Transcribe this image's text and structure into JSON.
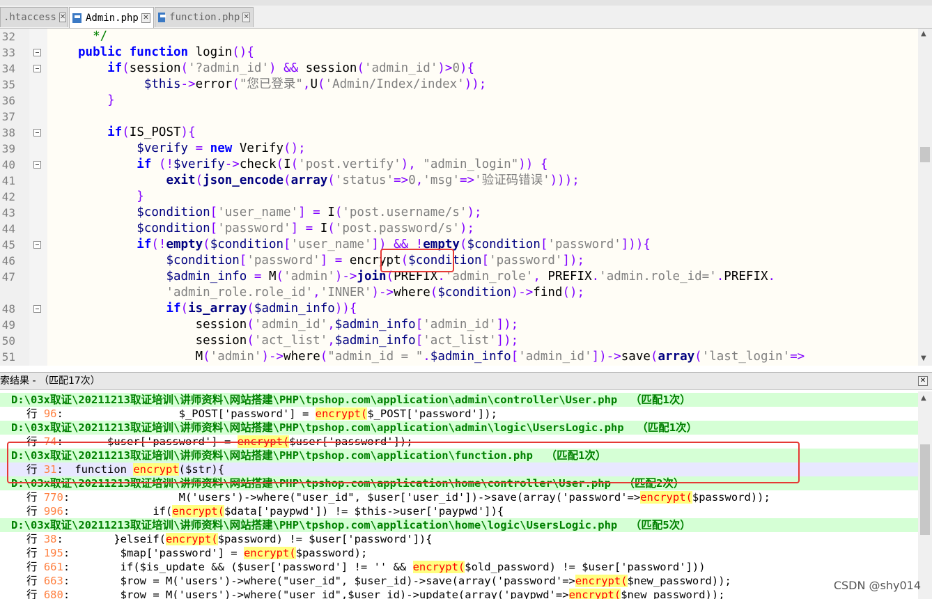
{
  "tabs": [
    {
      "label": ".htaccess",
      "active": false
    },
    {
      "label": "Admin.php",
      "active": true
    },
    {
      "label": "function.php",
      "active": false
    }
  ],
  "editor": {
    "lines": [
      {
        "n": "32",
        "fold": false,
        "segs": [
          [
            "cmt",
            "  */"
          ]
        ]
      },
      {
        "n": "33",
        "fold": true,
        "segs": [
          [
            "kw",
            "public function "
          ],
          [
            "plain",
            "login"
          ],
          [
            "op",
            "(){"
          ]
        ]
      },
      {
        "n": "34",
        "fold": true,
        "segs": [
          [
            "plain",
            "    "
          ],
          [
            "kw",
            "if"
          ],
          [
            "op",
            "("
          ],
          [
            "plain",
            "session"
          ],
          [
            "op",
            "("
          ],
          [
            "str",
            "'?admin_id'"
          ],
          [
            "op",
            ") && "
          ],
          [
            "plain",
            "session"
          ],
          [
            "op",
            "("
          ],
          [
            "str",
            "'admin_id'"
          ],
          [
            "op",
            ")>"
          ],
          [
            "str",
            "0"
          ],
          [
            "op",
            ")"
          ],
          [
            "op",
            "{"
          ]
        ]
      },
      {
        "n": "35",
        "fold": false,
        "segs": [
          [
            "plain",
            "         "
          ],
          [
            "var",
            "$this"
          ],
          [
            "op",
            "->"
          ],
          [
            "plain",
            "error"
          ],
          [
            "op",
            "("
          ],
          [
            "str",
            "\"您已登录\""
          ],
          [
            "op",
            ","
          ],
          [
            "plain",
            "U"
          ],
          [
            "op",
            "("
          ],
          [
            "str",
            "'Admin/Index/index'"
          ],
          [
            "op",
            "));"
          ]
        ]
      },
      {
        "n": "36",
        "fold": false,
        "segs": [
          [
            "plain",
            "    "
          ],
          [
            "op",
            "}"
          ]
        ]
      },
      {
        "n": "37",
        "fold": false,
        "segs": []
      },
      {
        "n": "38",
        "fold": true,
        "segs": [
          [
            "plain",
            "    "
          ],
          [
            "kw",
            "if"
          ],
          [
            "op",
            "("
          ],
          [
            "plain",
            "IS_POST"
          ],
          [
            "op",
            "){"
          ]
        ]
      },
      {
        "n": "39",
        "fold": false,
        "segs": [
          [
            "plain",
            "        "
          ],
          [
            "var",
            "$verify"
          ],
          [
            "op",
            " = "
          ],
          [
            "kw",
            "new "
          ],
          [
            "plain",
            "Verify"
          ],
          [
            "op",
            "();"
          ]
        ]
      },
      {
        "n": "40",
        "fold": true,
        "segs": [
          [
            "plain",
            "        "
          ],
          [
            "kw",
            "if"
          ],
          [
            "op",
            " (!"
          ],
          [
            "var",
            "$verify"
          ],
          [
            "op",
            "->"
          ],
          [
            "plain",
            "check"
          ],
          [
            "op",
            "("
          ],
          [
            "plain",
            "I"
          ],
          [
            "op",
            "("
          ],
          [
            "str",
            "'post.vertify'"
          ],
          [
            "op",
            "), "
          ],
          [
            "str",
            "\"admin_login\""
          ],
          [
            "op",
            ")) {"
          ]
        ]
      },
      {
        "n": "41",
        "fold": false,
        "segs": [
          [
            "plain",
            "            "
          ],
          [
            "fn",
            "exit"
          ],
          [
            "op",
            "("
          ],
          [
            "fn",
            "json_encode"
          ],
          [
            "op",
            "("
          ],
          [
            "fn",
            "array"
          ],
          [
            "op",
            "("
          ],
          [
            "str",
            "'status'"
          ],
          [
            "op",
            "=>"
          ],
          [
            "str",
            "0"
          ],
          [
            "op",
            ","
          ],
          [
            "str",
            "'msg'"
          ],
          [
            "op",
            "=>"
          ],
          [
            "str",
            "'验证码错误'"
          ],
          [
            "op",
            ")));"
          ]
        ]
      },
      {
        "n": "42",
        "fold": false,
        "segs": [
          [
            "plain",
            "        "
          ],
          [
            "op",
            "}"
          ]
        ]
      },
      {
        "n": "43",
        "fold": false,
        "segs": [
          [
            "plain",
            "        "
          ],
          [
            "var",
            "$condition"
          ],
          [
            "op",
            "["
          ],
          [
            "str",
            "'user_name'"
          ],
          [
            "op",
            "] = "
          ],
          [
            "plain",
            "I"
          ],
          [
            "op",
            "("
          ],
          [
            "str",
            "'post.username/s'"
          ],
          [
            "op",
            ");"
          ]
        ]
      },
      {
        "n": "44",
        "fold": false,
        "segs": [
          [
            "plain",
            "        "
          ],
          [
            "var",
            "$condition"
          ],
          [
            "op",
            "["
          ],
          [
            "str",
            "'password'"
          ],
          [
            "op",
            "] = "
          ],
          [
            "plain",
            "I"
          ],
          [
            "op",
            "("
          ],
          [
            "str",
            "'post.password/s'"
          ],
          [
            "op",
            ");"
          ]
        ]
      },
      {
        "n": "45",
        "fold": true,
        "segs": [
          [
            "plain",
            "        "
          ],
          [
            "kw",
            "if"
          ],
          [
            "op",
            "(!"
          ],
          [
            "fn",
            "empty"
          ],
          [
            "op",
            "("
          ],
          [
            "var",
            "$condition"
          ],
          [
            "op",
            "["
          ],
          [
            "str",
            "'user_name'"
          ],
          [
            "op",
            "]) && !"
          ],
          [
            "fn",
            "empty"
          ],
          [
            "op",
            "("
          ],
          [
            "var",
            "$condition"
          ],
          [
            "op",
            "["
          ],
          [
            "str",
            "'password'"
          ],
          [
            "op",
            "])){"
          ]
        ]
      },
      {
        "n": "46",
        "fold": false,
        "segs": [
          [
            "plain",
            "            "
          ],
          [
            "var",
            "$condition"
          ],
          [
            "op",
            "["
          ],
          [
            "str",
            "'password'"
          ],
          [
            "op",
            "] = "
          ],
          [
            "plain",
            "encrypt"
          ],
          [
            "op",
            "("
          ],
          [
            "var",
            "$condition"
          ],
          [
            "op",
            "["
          ],
          [
            "str",
            "'password'"
          ],
          [
            "op",
            "]);"
          ]
        ]
      },
      {
        "n": "47",
        "fold": false,
        "segs": [
          [
            "plain",
            "            "
          ],
          [
            "var",
            "$admin_info"
          ],
          [
            "op",
            " = "
          ],
          [
            "plain",
            "M"
          ],
          [
            "op",
            "("
          ],
          [
            "str",
            "'admin'"
          ],
          [
            "op",
            ")->"
          ],
          [
            "fn",
            "join"
          ],
          [
            "op",
            "("
          ],
          [
            "plain",
            "PREFIX"
          ],
          [
            "op",
            "."
          ],
          [
            "str",
            "'admin_role'"
          ],
          [
            "op",
            ", "
          ],
          [
            "plain",
            "PREFIX"
          ],
          [
            "op",
            "."
          ],
          [
            "str",
            "'admin.role_id='"
          ],
          [
            "op",
            "."
          ],
          [
            "plain",
            "PREFIX"
          ],
          [
            "op",
            "."
          ]
        ]
      },
      {
        "n": "",
        "fold": false,
        "segs": [
          [
            "plain",
            "            "
          ],
          [
            "str",
            "'admin_role.role_id'"
          ],
          [
            "op",
            ","
          ],
          [
            "str",
            "'INNER'"
          ],
          [
            "op",
            ")->"
          ],
          [
            "plain",
            "where"
          ],
          [
            "op",
            "("
          ],
          [
            "var",
            "$condition"
          ],
          [
            "op",
            ")->"
          ],
          [
            "plain",
            "find"
          ],
          [
            "op",
            "();"
          ]
        ]
      },
      {
        "n": "48",
        "fold": true,
        "segs": [
          [
            "plain",
            "            "
          ],
          [
            "kw",
            "if"
          ],
          [
            "op",
            "("
          ],
          [
            "fn",
            "is_array"
          ],
          [
            "op",
            "("
          ],
          [
            "var",
            "$admin_info"
          ],
          [
            "op",
            "))"
          ],
          [
            "op",
            "{"
          ]
        ]
      },
      {
        "n": "49",
        "fold": false,
        "segs": [
          [
            "plain",
            "                "
          ],
          [
            "plain",
            "session"
          ],
          [
            "op",
            "("
          ],
          [
            "str",
            "'admin_id'"
          ],
          [
            "op",
            ","
          ],
          [
            "var",
            "$admin_info"
          ],
          [
            "op",
            "["
          ],
          [
            "str",
            "'admin_id'"
          ],
          [
            "op",
            "]);"
          ]
        ]
      },
      {
        "n": "50",
        "fold": false,
        "segs": [
          [
            "plain",
            "                "
          ],
          [
            "plain",
            "session"
          ],
          [
            "op",
            "("
          ],
          [
            "str",
            "'act_list'"
          ],
          [
            "op",
            ","
          ],
          [
            "var",
            "$admin_info"
          ],
          [
            "op",
            "["
          ],
          [
            "str",
            "'act_list'"
          ],
          [
            "op",
            "]);"
          ]
        ]
      },
      {
        "n": "51",
        "fold": false,
        "segs": [
          [
            "plain",
            "                "
          ],
          [
            "plain",
            "M"
          ],
          [
            "op",
            "("
          ],
          [
            "str",
            "'admin'"
          ],
          [
            "op",
            ")->"
          ],
          [
            "plain",
            "where"
          ],
          [
            "op",
            "("
          ],
          [
            "str",
            "\"admin_id = \""
          ],
          [
            "op",
            "."
          ],
          [
            "var",
            "$admin_info"
          ],
          [
            "op",
            "["
          ],
          [
            "str",
            "'admin_id'"
          ],
          [
            "op",
            "])->"
          ],
          [
            "plain",
            "save"
          ],
          [
            "op",
            "("
          ],
          [
            "fn",
            "array"
          ],
          [
            "op",
            "("
          ],
          [
            "str",
            "'last_login'"
          ],
          [
            "op",
            "=>"
          ]
        ]
      }
    ]
  },
  "search_panel": {
    "title": "索结果 - （匹配17次）",
    "rows": [
      {
        "type": "file",
        "text": "D:\\03x取证\\20211213取证培训\\讲师资料\\网站搭建\\PHP\\tpshop.com\\application\\admin\\controller\\User.php  （匹配1次）"
      },
      {
        "type": "line",
        "ln": "96",
        "pre": "                 $_POST['password'] = ",
        "match": "encrypt(",
        "post": "$_POST['password']);"
      },
      {
        "type": "file",
        "text": "D:\\03x取证\\20211213取证培训\\讲师资料\\网站搭建\\PHP\\tpshop.com\\application\\admin\\logic\\UsersLogic.php  （匹配1次）"
      },
      {
        "type": "line",
        "ln": "74",
        "pre": "      $user['password'] = ",
        "match": "encrypt(",
        "post": "$user['password']);"
      },
      {
        "type": "file",
        "text": "D:\\03x取证\\20211213取证培训\\讲师资料\\网站搭建\\PHP\\tpshop.com\\application\\function.php  （匹配1次）"
      },
      {
        "type": "line",
        "ln": "31",
        "pre": " function ",
        "match": "encrypt",
        "post": "($str){",
        "selected": true
      },
      {
        "type": "file",
        "text": "D:\\03x取证\\20211213取证培训\\讲师资料\\网站搭建\\PHP\\tpshop.com\\application\\home\\controller\\User.php  （匹配2次）"
      },
      {
        "type": "line",
        "ln": "770",
        "pre": "                 M('users')->where(\"user_id\", $user['user_id'])->save(array('password'=>",
        "match": "encrypt(",
        "post": "$password));"
      },
      {
        "type": "line",
        "ln": "996",
        "pre": "             if(",
        "match": "encrypt(",
        "post": "$data['paypwd']) != $this->user['paypwd']){"
      },
      {
        "type": "file",
        "text": "D:\\03x取证\\20211213取证培训\\讲师资料\\网站搭建\\PHP\\tpshop.com\\application\\home\\logic\\UsersLogic.php  （匹配5次）"
      },
      {
        "type": "line",
        "ln": "38",
        "pre": "       }elseif(",
        "match": "encrypt(",
        "post": "$password) != $user['password']){"
      },
      {
        "type": "line",
        "ln": "195",
        "pre": "        $map['password'] = ",
        "match": "encrypt(",
        "post": "$password);"
      },
      {
        "type": "line",
        "ln": "661",
        "pre": "        if($is_update && ($user['password'] != '' && ",
        "match": "encrypt(",
        "post": "$old_password) != $user['password']))"
      },
      {
        "type": "line",
        "ln": "663",
        "pre": "        $row = M('users')->where(\"user_id\", $user_id)->save(array('password'=>",
        "match": "encrypt(",
        "post": "$new_password));"
      },
      {
        "type": "line",
        "ln": "680",
        "pre": "        $row = M('users')->where(\"user_id\",$user_id)->update(array('paypwd'=>",
        "match": "encrypt(",
        "post": "$new_password));"
      }
    ]
  },
  "line_prefix": "行 ",
  "watermark": "CSDN @shy014"
}
